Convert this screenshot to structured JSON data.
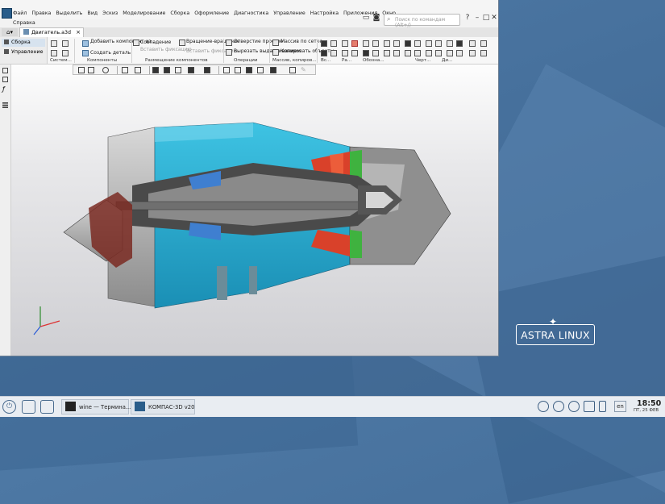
{
  "window": {
    "menu": [
      "Файл",
      "Правка",
      "Выделить",
      "Вид",
      "Эскиз",
      "Моделирование",
      "Сборка",
      "Оформление",
      "Диагностика",
      "Управление",
      "Настройка",
      "Приложения",
      "Окно"
    ],
    "menu_second_row": "Справка",
    "command_search_placeholder": "Поиск по командам (Alt+/)",
    "home_tab_icon": "home-icon",
    "document_tab": "Двигатель.a3d"
  },
  "left_panel": {
    "items": [
      "Сборка",
      "Управление"
    ]
  },
  "ribbon": {
    "components": {
      "add_component": "Добавить компонент из...",
      "create_part": "Создать деталь"
    },
    "placement": {
      "coincidence": "Совпадение",
      "rotate_move": "Вращение-вращение",
      "insert_fasteners": "Вставить фиксацию",
      "insert_fixation": "Вставить фиксацию"
    },
    "operations": {
      "hole_simple": "Отверстие простое",
      "cut_extrude": "Вырезать выдавливанием"
    },
    "array": {
      "array_by_grid": "Массив по сетке",
      "copy_objects": "Копировать объекты"
    },
    "groups": [
      "Систем...",
      "Компоненты",
      "Размещение компонентов",
      "Операции",
      "Массив, копиров...",
      "Вс...",
      "Ра...",
      "Обозна...",
      "Черт...",
      "Ди..."
    ]
  },
  "desktop": {
    "brand": "ASTRA LINUX"
  },
  "taskbar": {
    "tasks": [
      {
        "label": "wine — Термина..."
      },
      {
        "label": "КОМПАС-3D v20"
      }
    ],
    "language": "en",
    "time": "18:50",
    "date": "ПТ, 25 ФЕВ"
  },
  "colors": {
    "desktop": "#46709c",
    "engine_casing": "#2fb2d4",
    "engine_red": "#d9412a",
    "engine_green": "#3fb23f"
  }
}
